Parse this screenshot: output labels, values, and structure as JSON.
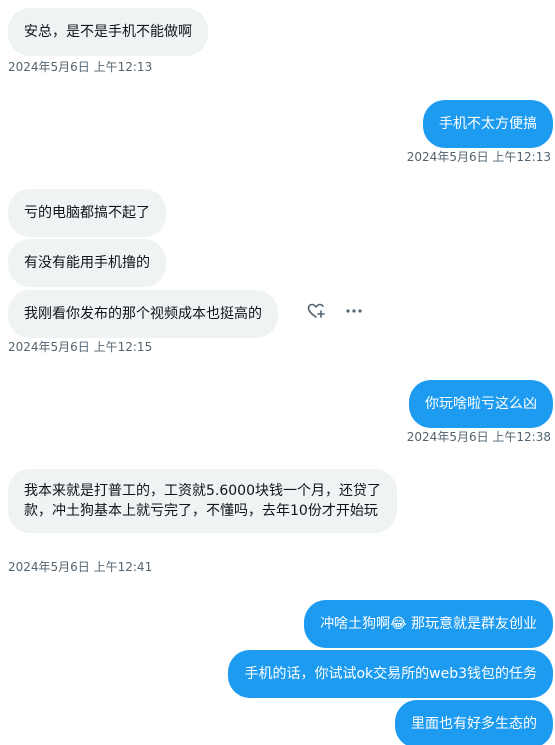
{
  "messages": [
    {
      "text": "安总，是不是手机不能做啊",
      "side": "in"
    },
    {
      "timestamp": "2024年5月6日 上午12:13"
    },
    {
      "text": "手机不太方便搞",
      "side": "out"
    },
    {
      "timestamp": "2024年5月6日 上午12:13"
    },
    {
      "text": "亏的电脑都搞不起了",
      "side": "in"
    },
    {
      "text": "有没有能用手机撸的",
      "side": "in"
    },
    {
      "text": "我刚看你发布的那个视频成本也挺高的",
      "side": "in"
    },
    {
      "timestamp": "2024年5月6日 上午12:15"
    },
    {
      "text": "你玩啥啦亏这么凶",
      "side": "out"
    },
    {
      "timestamp": "2024年5月6日 上午12:38"
    },
    {
      "text": "我本来就是打普工的，工资就5.6000块钱一个月，还贷了款，冲土狗基本上就亏完了，不懂吗，去年10份才开始玩",
      "side": "in"
    },
    {
      "timestamp": "2024年5月6日 上午12:41"
    },
    {
      "text_before": "冲啥土狗啊",
      "emoji": "😂",
      "text_after": " 那玩意就是群友创业",
      "side": "out"
    },
    {
      "text": "手机的话，你试试ok交易所的web3钱包的任务",
      "side": "out"
    },
    {
      "text": "里面也有好多生态的",
      "side": "out"
    }
  ],
  "icons": {
    "react": "add-reaction-heart-icon",
    "more": "more-horizontal-icon"
  },
  "colors": {
    "incoming_bg": "#eff3f4",
    "outgoing_bg": "#1d9bf0",
    "timestamp": "#536471"
  }
}
